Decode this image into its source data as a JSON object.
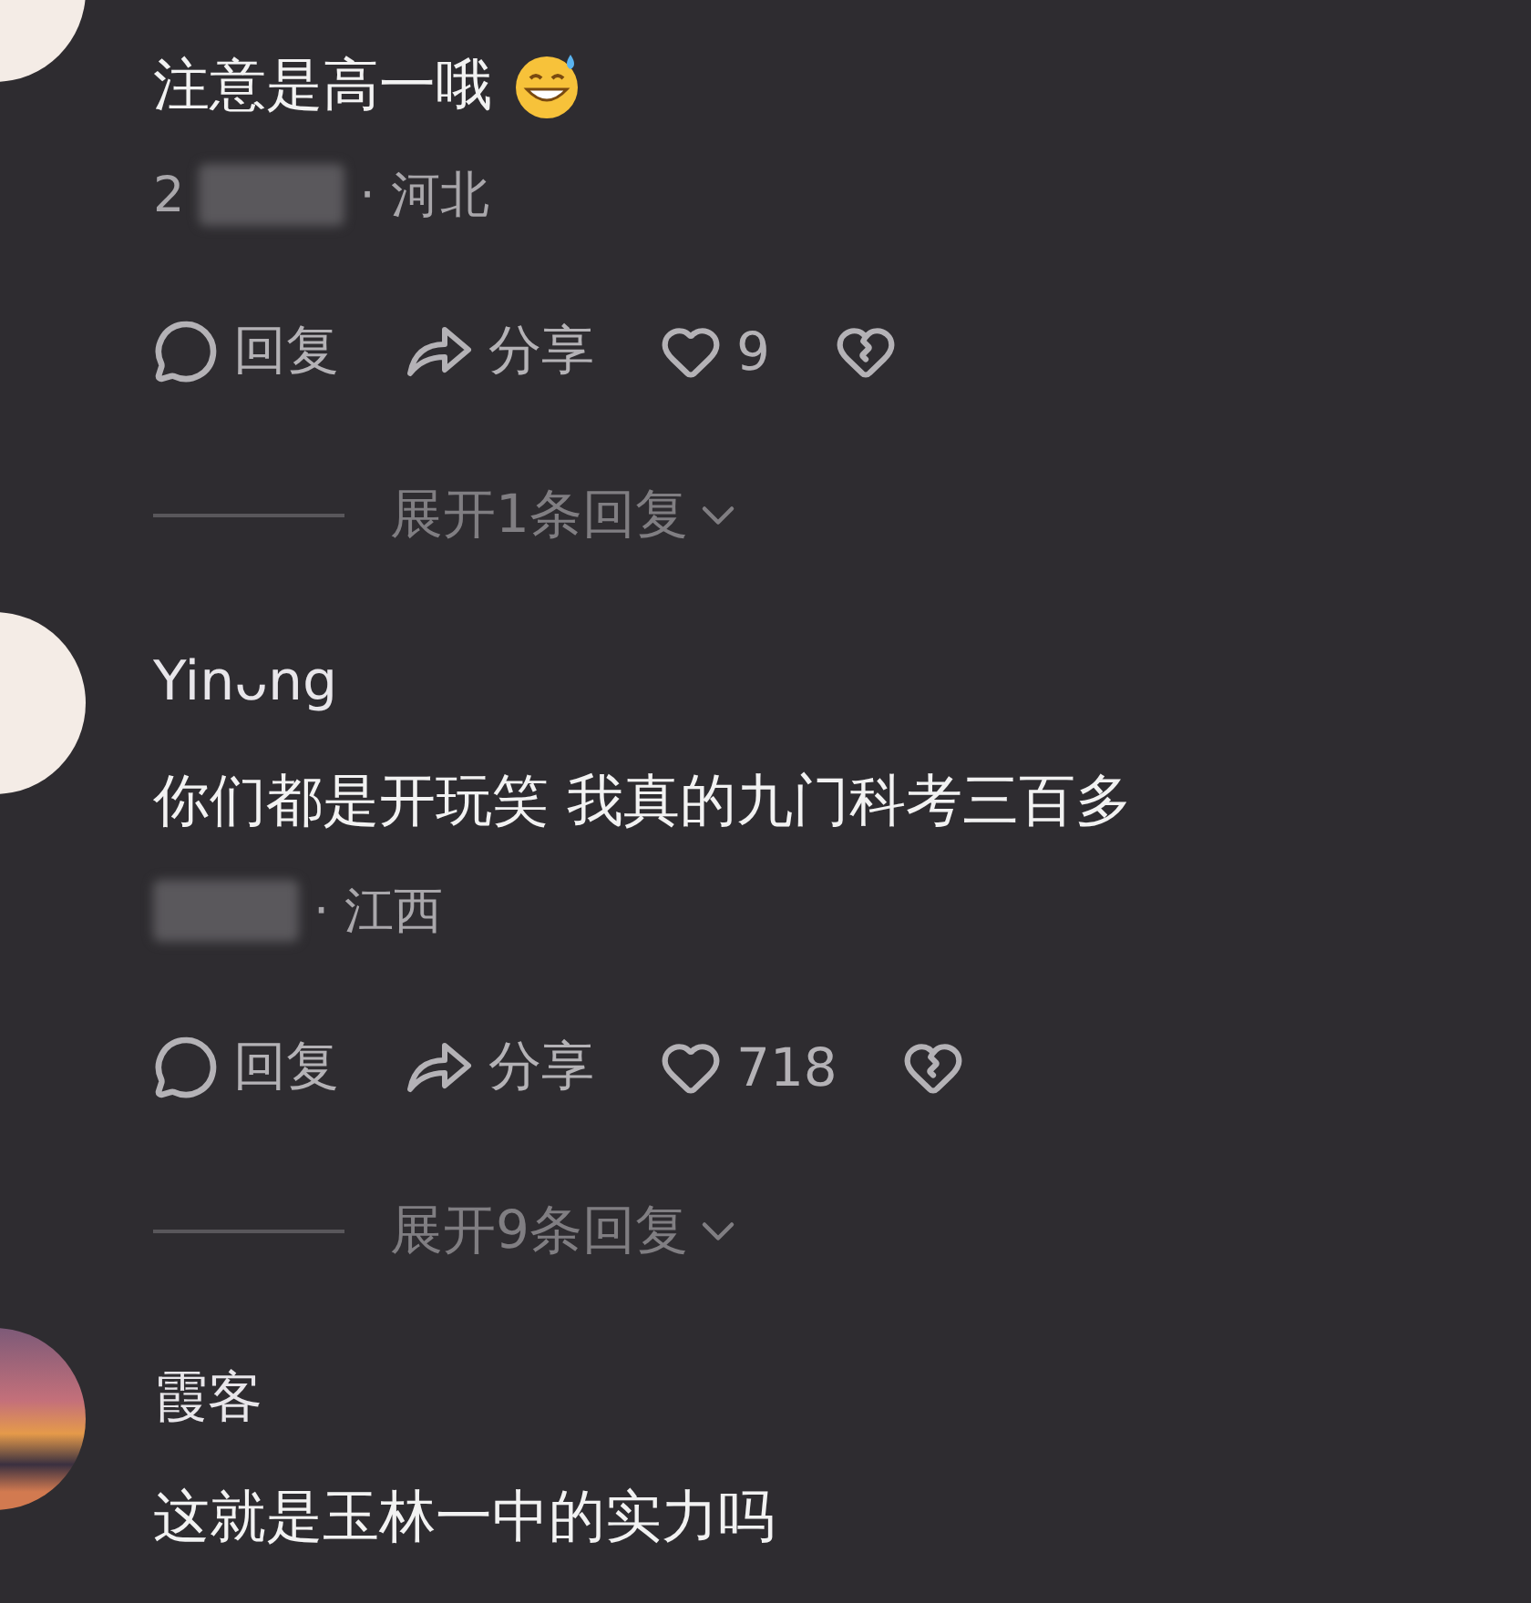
{
  "comments": [
    {
      "avatar": {
        "kind": "drawing"
      },
      "text": "注意是高一哦",
      "has_emoji": true,
      "date": "2",
      "location": "· 河北",
      "actions": {
        "reply": "回复",
        "share": "分享",
        "likes": "9"
      },
      "expand": "展开1条回复"
    },
    {
      "avatar": {
        "kind": "drawing"
      },
      "name": "Yinᴗng",
      "text": "你们都是开玩笑 我真的九门科考三百多",
      "has_emoji": false,
      "location": "· 江西",
      "actions": {
        "reply": "回复",
        "share": "分享",
        "likes": "718"
      },
      "expand": "展开9条回复"
    },
    {
      "avatar": {
        "kind": "photo"
      },
      "name": "霞客",
      "text": "这就是玉林一中的实力吗",
      "has_emoji": false
    }
  ]
}
